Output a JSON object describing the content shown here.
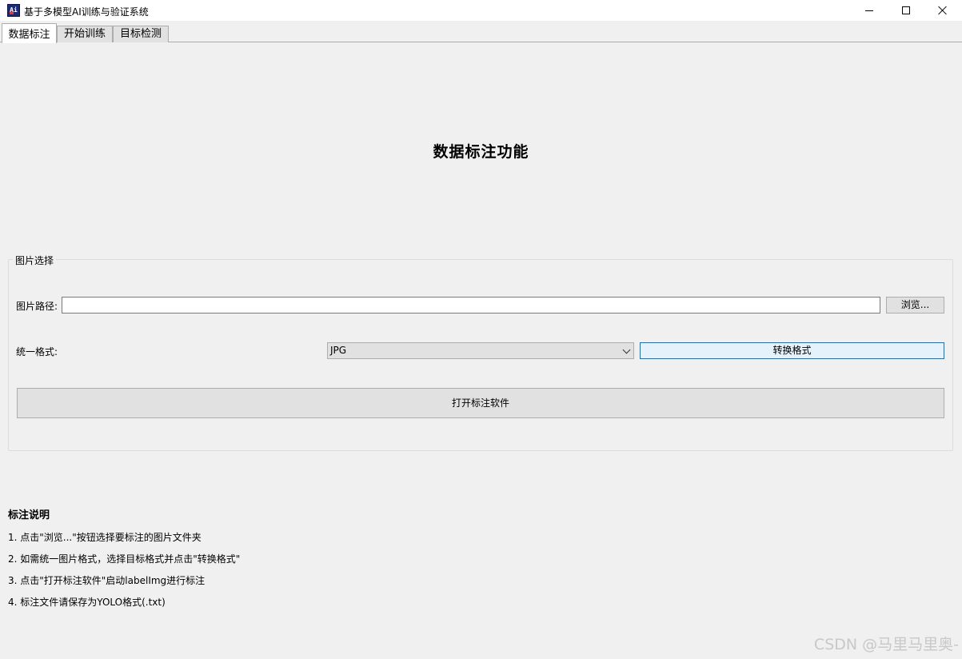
{
  "window": {
    "title": "基于多模型AI训练与验证系统",
    "icon": "app-logo-icon"
  },
  "tabs": [
    {
      "label": "数据标注",
      "active": true
    },
    {
      "label": "开始训练",
      "active": false
    },
    {
      "label": "目标检测",
      "active": false
    }
  ],
  "main": {
    "heading": "数据标注功能",
    "group": {
      "legend": "图片选择",
      "path_label": "图片路径:",
      "path_value": "",
      "browse_label": "浏览...",
      "format_label": "统一格式:",
      "format_selected": "JPG",
      "convert_label": "转换格式",
      "open_tool_label": "打开标注软件"
    }
  },
  "instructions": {
    "title": "标注说明",
    "items": [
      "1. 点击\"浏览...\"按钮选择要标注的图片文件夹",
      "2. 如需统一图片格式，选择目标格式并点击\"转换格式\"",
      "3. 点击\"打开标注软件\"启动labelImg进行标注",
      "4. 标注文件请保存为YOLO格式(.txt)"
    ]
  },
  "watermark": "CSDN @马里马里奥-",
  "colors": {
    "background": "#f0f0f0",
    "focus_border": "#0078d7",
    "focus_fill": "#e5f1fb"
  }
}
